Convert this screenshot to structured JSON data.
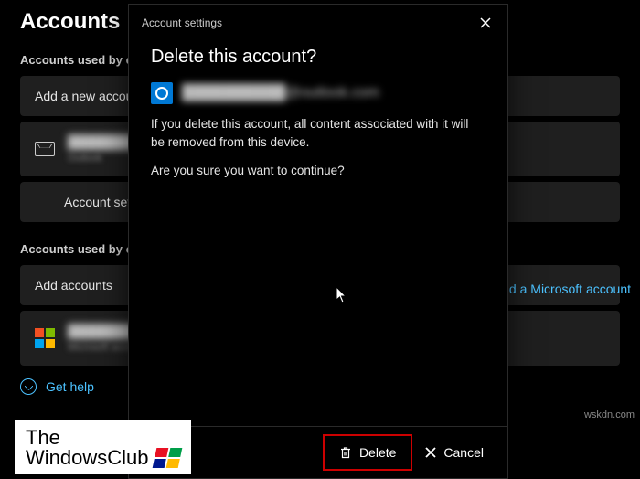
{
  "page": {
    "title": "Accounts",
    "section_email": "Accounts used by email, calendar, and contacts",
    "add_account": "Add a new account",
    "email_account_name": "████████████",
    "email_account_sub": "Outlook",
    "account_settings_item": "Account settings",
    "section_other": "Accounts used by other apps",
    "add_accounts": "Add accounts",
    "add_ms_account": "Add a Microsoft account",
    "ms_account_name": "████████████",
    "ms_account_sub": "Microsoft account",
    "get_help": "Get help"
  },
  "dialog": {
    "header": "Account settings",
    "title": "Delete this account?",
    "account_email": "██████████@outlook.com",
    "warning": "If you delete this account, all content associated with it will be removed from this device.",
    "confirm": "Are you sure you want to continue?",
    "delete": "Delete",
    "cancel": "Cancel"
  },
  "watermark": {
    "line1": "The",
    "line2": "WindowsClub"
  },
  "source": "wskdn.com"
}
